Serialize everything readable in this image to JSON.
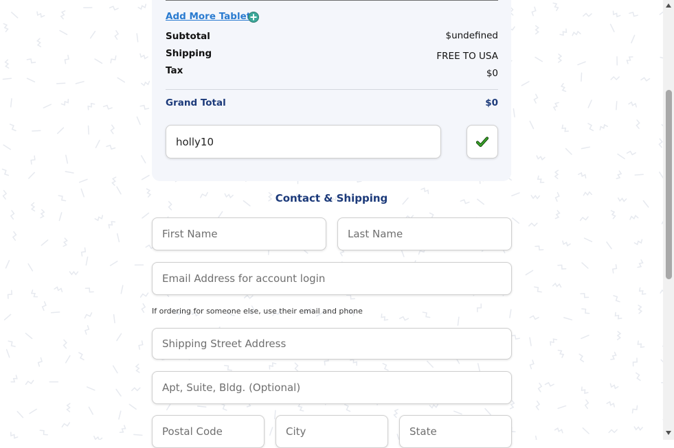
{
  "summary": {
    "add_more_label": "Add More Tablets",
    "subtotal_label": "Subtotal",
    "subtotal_value": "$undefined",
    "shipping_label": "Shipping",
    "shipping_value": "FREE TO USA",
    "tax_label": "Tax",
    "tax_value": "$0",
    "grand_total_label": "Grand Total",
    "grand_total_value": "$0"
  },
  "promo": {
    "value": "holly10",
    "apply_icon": "checkmark-icon"
  },
  "contact": {
    "title": "Contact & Shipping",
    "first_name_placeholder": "First Name",
    "last_name_placeholder": "Last Name",
    "email_placeholder": "Email Address for account login",
    "hint": "If ordering for someone else, use their email and phone",
    "street_placeholder": "Shipping Street Address",
    "apt_placeholder": "Apt, Suite, Bldg. (Optional)",
    "postal_placeholder": "Postal Code",
    "city_placeholder": "City",
    "state_placeholder": "State"
  },
  "colors": {
    "accent_blue": "#1c3a7a",
    "link_blue": "#2a7bd0",
    "plus_green": "#3ca89a",
    "check_green": "#2e8b1e"
  }
}
